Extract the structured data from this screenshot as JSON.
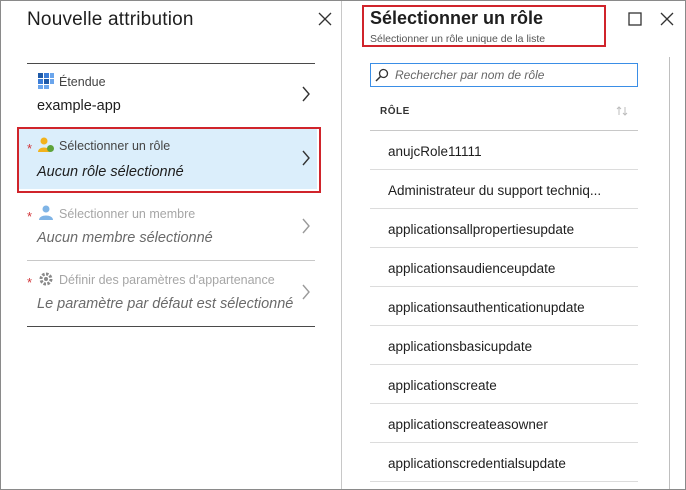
{
  "left_blade": {
    "title": "Nouvelle attribution",
    "rows": [
      {
        "label": "Étendue",
        "value": "example-app",
        "required": false,
        "icon": "scope-grid-icon"
      },
      {
        "label": "Sélectionner un rôle",
        "value": "Aucun rôle sélectionné",
        "required": true,
        "icon": "user-role-icon"
      },
      {
        "label": "Sélectionner un membre",
        "value": "Aucun membre sélectionné",
        "required": true,
        "icon": "user-icon"
      },
      {
        "label": "Définir des paramètres d'appartenance",
        "value": "Le paramètre par défaut est sélectionné",
        "required": true,
        "icon": "gear-icon"
      }
    ],
    "required_marker": "*"
  },
  "right_blade": {
    "title": "Sélectionner un rôle",
    "subtitle": "Sélectionner un rôle unique de la liste",
    "search": {
      "placeholder": "Rechercher par nom de rôle",
      "value": ""
    },
    "column_header": "RÔLE",
    "roles": [
      "anujcRole11111",
      "Administrateur du support techniq...",
      "applicationsallpropertiesupdate",
      "applicationsaudienceupdate",
      "applicationsauthenticationupdate",
      "applicationsbasicupdate",
      "applicationscreate",
      "applicationscreateasowner",
      "applicationscredentialsupdate"
    ]
  },
  "colors": {
    "highlight_box": "#d0242b",
    "selected_row_bg": "#dbeefb",
    "search_border": "#3a8ee6",
    "required_star": "#d13438"
  }
}
